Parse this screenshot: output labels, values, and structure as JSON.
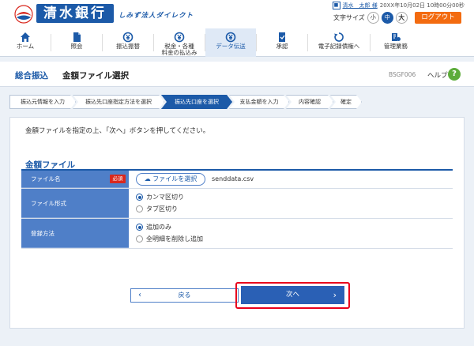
{
  "header": {
    "bank_name": "清水銀行",
    "sub_brand": "しみず法人ダイレクト",
    "user_name": "清水　太郎 様",
    "last_login": "20XX年10月02日 10時00分00秒",
    "font_size_label": "文字サイズ",
    "font_sizes": [
      "小",
      "中",
      "大"
    ],
    "logout": "ログアウト"
  },
  "nav": {
    "items": [
      {
        "label": "ホーム",
        "icon": "home-icon"
      },
      {
        "label": "照会",
        "icon": "document-icon"
      },
      {
        "label": "振込振替",
        "icon": "yen-transfer-icon"
      },
      {
        "label": "税金・各種\n料金の払込み",
        "icon": "yen-payment-icon"
      },
      {
        "label": "データ伝送",
        "icon": "data-transfer-icon"
      },
      {
        "label": "承認",
        "icon": "approval-icon"
      },
      {
        "label": "電子記録債権へ",
        "icon": "cycle-icon"
      },
      {
        "label": "管理業務",
        "icon": "admin-icon"
      }
    ],
    "active_index": 4
  },
  "titlebar": {
    "section": "総合振込",
    "page": "金額ファイル選択",
    "code": "BSGF006",
    "help": "ヘルプ"
  },
  "steps": [
    "振込元情報を入力",
    "振込先口座指定方法を選択",
    "振込先口座を選択",
    "支払金額を入力",
    "内容確認",
    "確定"
  ],
  "instruction": "金額ファイルを指定の上、「次へ」ボタンを押してください。",
  "section_title": "金額ファイル",
  "form": {
    "file": {
      "label": "ファイル名",
      "required": "必須",
      "button": "ファイルを選択",
      "filename": "senddata.csv"
    },
    "format": {
      "label": "ファイル形式",
      "options": [
        "カンマ区切り",
        "タブ区切り"
      ],
      "selected": 0
    },
    "method": {
      "label": "登録方法",
      "options": [
        "追加のみ",
        "全明細を削除し追加"
      ],
      "selected": 0
    }
  },
  "buttons": {
    "back": "戻る",
    "next": "次へ"
  },
  "colors": {
    "brand": "#1c5aa8",
    "logout": "#f36b10",
    "required": "#d9281e",
    "highlight": "#e8001c"
  }
}
